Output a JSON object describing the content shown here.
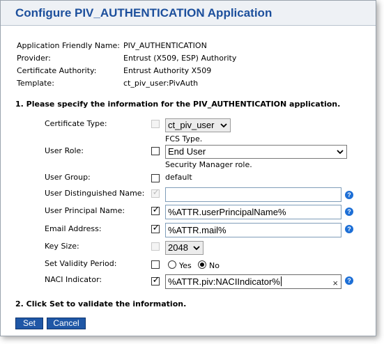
{
  "page": {
    "title": "Configure PIV_AUTHENTICATION Application"
  },
  "info": [
    {
      "label": "Application Friendly Name:",
      "value": "PIV_AUTHENTICATION"
    },
    {
      "label": "Provider:",
      "value": "Entrust (X509, ESP) Authority"
    },
    {
      "label": "Certificate Authority:",
      "value": "Entrust Authority X509"
    },
    {
      "label": "Template:",
      "value": "ct_piv_user:PivAuth"
    }
  ],
  "section1": {
    "heading": "1. Please specify the information for the PIV_AUTHENTICATION application."
  },
  "fields": {
    "certificate_type": {
      "label": "Certificate Type:",
      "checked": false,
      "enabled": false,
      "selected": "ct_piv_user",
      "hint": "FCS Type."
    },
    "user_role": {
      "label": "User Role:",
      "checked": false,
      "enabled": true,
      "selected": "End User",
      "hint": "Security Manager role."
    },
    "user_group": {
      "label": "User Group:",
      "checked": false,
      "enabled": true,
      "value": "default"
    },
    "user_dn": {
      "label": "User Distinguished Name:",
      "checked": true,
      "enabled": false,
      "value": ""
    },
    "user_principal_name": {
      "label": "User Principal Name:",
      "checked": true,
      "enabled": true,
      "value": "%ATTR.userPrincipalName%"
    },
    "email_address": {
      "label": "Email Address:",
      "checked": true,
      "enabled": true,
      "value": "%ATTR.mail%"
    },
    "key_size": {
      "label": "Key Size:",
      "checked": false,
      "enabled": false,
      "selected": "2048"
    },
    "set_validity_period": {
      "label": "Set Validity Period:",
      "checked": false,
      "enabled": true,
      "options": [
        "Yes",
        "No"
      ],
      "selected": "No"
    },
    "naci_indicator": {
      "label": "NACI Indicator:",
      "checked": true,
      "enabled": true,
      "value": "%ATTR.piv:NACIIndicator%",
      "clear_icon": "×"
    }
  },
  "icons": {
    "help_glyph": "?",
    "check_glyph": "✓"
  },
  "section2": {
    "heading": "2. Click Set to validate the information."
  },
  "buttons": {
    "set": "Set",
    "cancel": "Cancel"
  },
  "colors": {
    "title": "#1c4f9c",
    "button_bg": "#1f57a6",
    "help_icon": "#1d6fd6"
  }
}
